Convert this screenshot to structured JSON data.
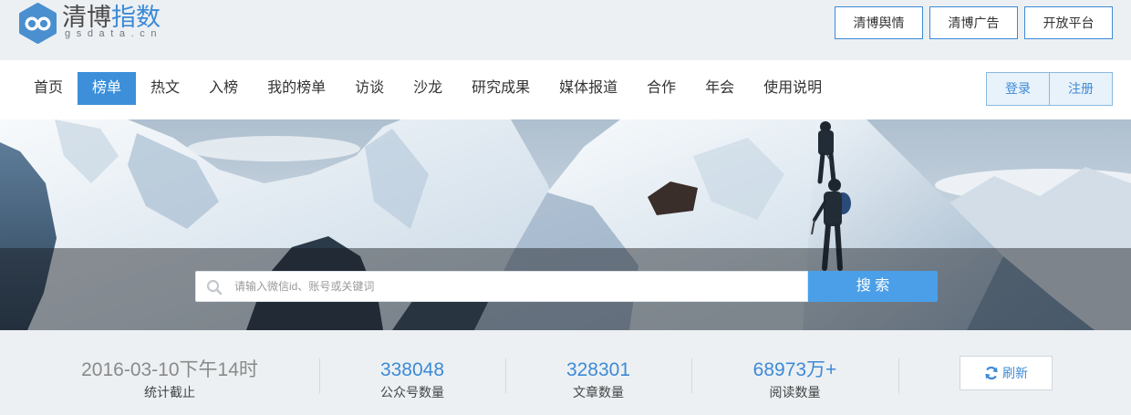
{
  "logo": {
    "name_part1": "清博",
    "name_part2": "指数",
    "domain": "gsdata.cn",
    "icon": "hexagon-infinity-icon"
  },
  "top_links": [
    {
      "label": "清博舆情"
    },
    {
      "label": "清博广告"
    },
    {
      "label": "开放平台"
    }
  ],
  "nav": {
    "items": [
      {
        "label": "首页",
        "active": false
      },
      {
        "label": "榜单",
        "active": true
      },
      {
        "label": "热文",
        "active": false
      },
      {
        "label": "入榜",
        "active": false
      },
      {
        "label": "我的榜单",
        "active": false
      },
      {
        "label": "访谈",
        "active": false
      },
      {
        "label": "沙龙",
        "active": false
      },
      {
        "label": "研究成果",
        "active": false
      },
      {
        "label": "媒体报道",
        "active": false
      },
      {
        "label": "合作",
        "active": false
      },
      {
        "label": "年会",
        "active": false
      },
      {
        "label": "使用说明",
        "active": false
      }
    ]
  },
  "auth": {
    "login_label": "登录",
    "register_label": "注册"
  },
  "search": {
    "placeholder": "请输入微信id、账号或关键词",
    "value": "",
    "button_label": "搜 索",
    "icon": "search-icon"
  },
  "stats": [
    {
      "value": "2016-03-10下午14时",
      "label": "统计截止"
    },
    {
      "value": "338048",
      "label": "公众号数量"
    },
    {
      "value": "328301",
      "label": "文章数量"
    },
    {
      "value": "68973万+",
      "label": "阅读数量"
    }
  ],
  "refresh": {
    "label": "刷新",
    "icon": "refresh-icon"
  },
  "colors": {
    "brand_blue": "#3d8ad6",
    "nav_active_bg": "#3d8fd9",
    "search_button_bg": "#4a9fe8",
    "page_bg": "#ecf0f3",
    "logo_blue": "#4a8fcf"
  }
}
